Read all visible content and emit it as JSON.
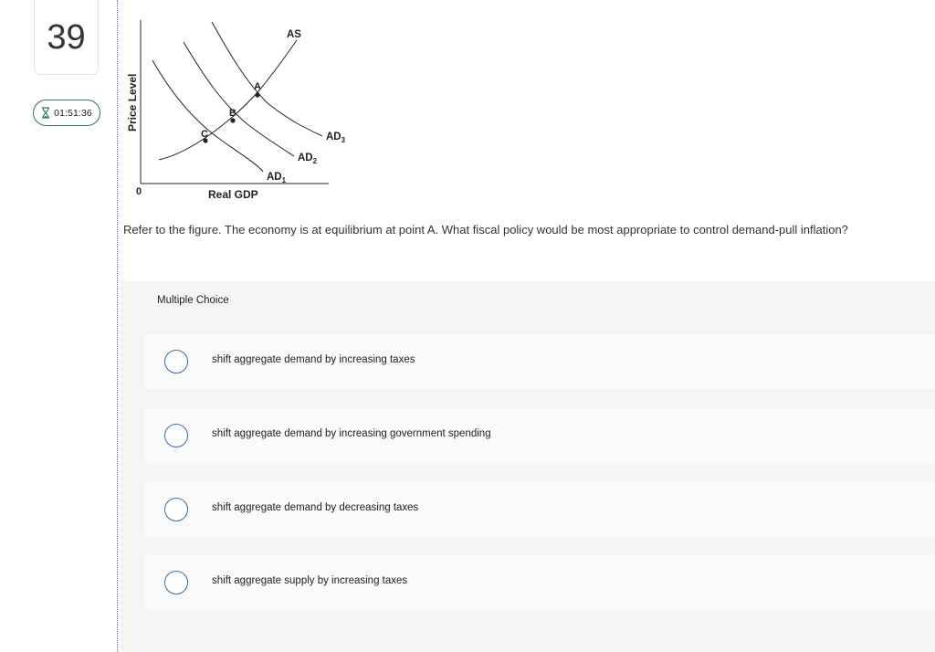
{
  "question_number": "39",
  "timer": {
    "icon": "hourglass-icon",
    "text": "01:51:36",
    "accent_color": "#2d7a4b"
  },
  "figure": {
    "y_axis_label": "Price Level",
    "x_axis_label": "Real GDP",
    "origin_label": "0",
    "curves": {
      "as": "AS",
      "ad1": "AD",
      "ad1_sub": "1",
      "ad2": "AD",
      "ad2_sub": "2",
      "ad3": "AD",
      "ad3_sub": "3"
    },
    "points": {
      "a": "A",
      "b": "B",
      "c": "C"
    }
  },
  "question_text": "Refer to the figure. The economy is at equilibrium at point A. What fiscal policy would be most appropriate to control demand-pull inflation?",
  "multiple_choice": {
    "label": "Multiple Choice",
    "options": [
      "shift aggregate demand by increasing taxes",
      "shift aggregate demand by increasing government spending",
      "shift aggregate demand by decreasing taxes",
      "shift aggregate supply by increasing taxes"
    ],
    "radio_color": "#2f6fb2"
  }
}
